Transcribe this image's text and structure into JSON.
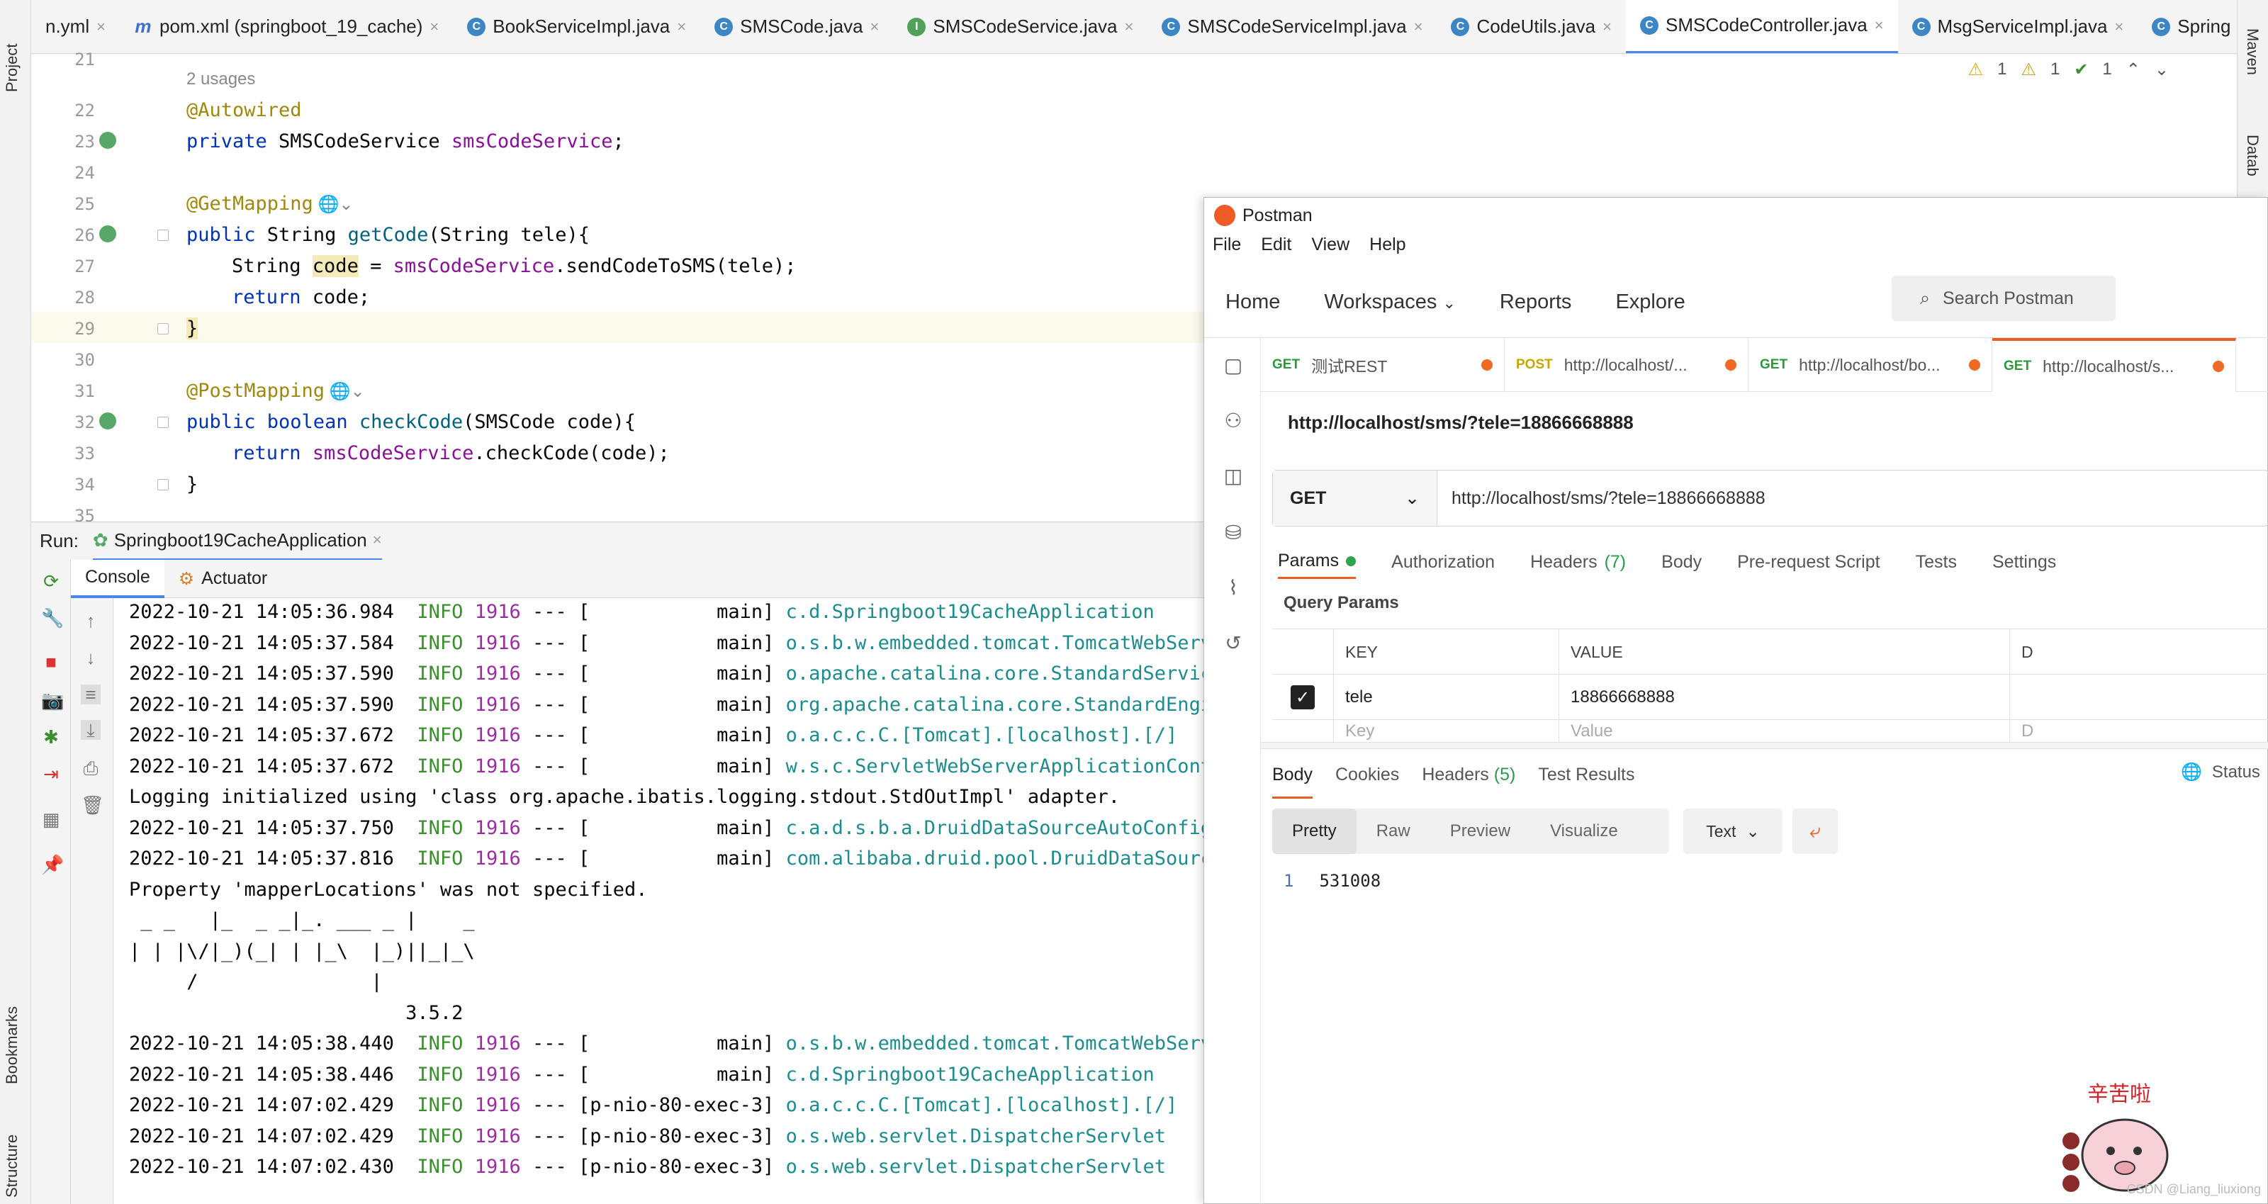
{
  "ide": {
    "left_stripe": {
      "project": "Project",
      "bookmarks": "Bookmarks",
      "structure": "Structure"
    },
    "right_stripe": {
      "maven": "Maven",
      "database": "Datab"
    },
    "tabs": [
      {
        "label": "n.yml",
        "icon": "yaml-file-icon"
      },
      {
        "label": "pom.xml (springboot_19_cache)",
        "icon": "maven-file-icon"
      },
      {
        "label": "BookServiceImpl.java",
        "icon": "class-file-icon"
      },
      {
        "label": "SMSCode.java",
        "icon": "class-file-icon"
      },
      {
        "label": "SMSCodeService.java",
        "icon": "interface-file-icon"
      },
      {
        "label": "SMSCodeServiceImpl.java",
        "icon": "class-file-icon"
      },
      {
        "label": "CodeUtils.java",
        "icon": "class-file-icon"
      },
      {
        "label": "SMSCodeController.java",
        "icon": "class-file-icon",
        "active": true
      },
      {
        "label": "MsgServiceImpl.java",
        "icon": "class-file-icon"
      },
      {
        "label": "Spring",
        "icon": "class-file-icon"
      }
    ],
    "inspections": {
      "warn1": "1",
      "warn2": "1",
      "ok": "1"
    },
    "editor": {
      "usages": "2 usages",
      "line_numbers": [
        "21",
        "22",
        "23",
        "24",
        "25",
        "26",
        "27",
        "28",
        "29",
        "30",
        "31",
        "32",
        "33",
        "34",
        "35"
      ],
      "lines": {
        "l22": "@Autowired",
        "l23_kw": "private",
        "l23_type": " SMSCodeService ",
        "l23_field": "smsCodeService",
        "l23_end": ";",
        "l25": "@GetMapping",
        "l26_kw": "public",
        "l26_rest1": " String ",
        "l26_method": "getCode",
        "l26_rest2": "(String tele){",
        "l27_a": "String ",
        "l27_var": "code",
        "l27_b": " = ",
        "l27_field": "smsCodeService",
        "l27_c": ".sendCodeToSMS(tele);",
        "l28_kw": "return",
        "l28_rest": " code;",
        "l29": "}",
        "l31": "@PostMapping",
        "l32_kw": "public boolean",
        "l32_method": " checkCode",
        "l32_rest": "(SMSCode code){",
        "l33_kw": "return",
        "l33_field": " smsCodeService",
        "l33_rest": ".checkCode(code);",
        "l34": "}"
      }
    },
    "run": {
      "label": "Run:",
      "config": "Springboot19CacheApplication",
      "console_tab": "Console",
      "actuator_tab": "Actuator"
    },
    "console_lines": [
      {
        "ts": "2022-10-21 14:05:36.984",
        "level": "INFO",
        "pid": "1916",
        "thread": "--- [           main]",
        "cls": "c.d.Springboot19CacheApplication"
      },
      {
        "ts": "2022-10-21 14:05:37.584",
        "level": "INFO",
        "pid": "1916",
        "thread": "--- [           main]",
        "cls": "o.s.b.w.embedded.tomcat.TomcatWebServe"
      },
      {
        "ts": "2022-10-21 14:05:37.590",
        "level": "INFO",
        "pid": "1916",
        "thread": "--- [           main]",
        "cls": "o.apache.catalina.core.StandardService"
      },
      {
        "ts": "2022-10-21 14:05:37.590",
        "level": "INFO",
        "pid": "1916",
        "thread": "--- [           main]",
        "cls": "org.apache.catalina.core.StandardEngin"
      },
      {
        "ts": "2022-10-21 14:05:37.672",
        "level": "INFO",
        "pid": "1916",
        "thread": "--- [           main]",
        "cls": "o.a.c.c.C.[Tomcat].[localhost].[/]"
      },
      {
        "ts": "2022-10-21 14:05:37.672",
        "level": "INFO",
        "pid": "1916",
        "thread": "--- [           main]",
        "cls": "w.s.c.ServletWebServerApplicationConte"
      }
    ],
    "console_plain1": "Logging initialized using 'class org.apache.ibatis.logging.stdout.StdOutImpl' adapter.",
    "console_lines2": [
      {
        "ts": "2022-10-21 14:05:37.750",
        "level": "INFO",
        "pid": "1916",
        "thread": "--- [           main]",
        "cls": "c.a.d.s.b.a.DruidDataSourceAutoConfigu"
      },
      {
        "ts": "2022-10-21 14:05:37.816",
        "level": "INFO",
        "pid": "1916",
        "thread": "--- [           main]",
        "cls": "com.alibaba.druid.pool.DruidDataSource"
      }
    ],
    "console_plain2": "Property 'mapperLocations' was not specified.",
    "banner": [
      " _ _   |_  _ _|_. ___ _ |    _",
      "| | |\\/|_)(_| | |_\\  |_)||_|_\\",
      "     /               |",
      "                        3.5.2"
    ],
    "console_lines3": [
      {
        "ts": "2022-10-21 14:05:38.440",
        "level": "INFO",
        "pid": "1916",
        "thread": "--- [           main]",
        "cls": "o.s.b.w.embedded.tomcat.TomcatWebServe"
      },
      {
        "ts": "2022-10-21 14:05:38.446",
        "level": "INFO",
        "pid": "1916",
        "thread": "--- [           main]",
        "cls": "c.d.Springboot19CacheApplication"
      },
      {
        "ts": "2022-10-21 14:07:02.429",
        "level": "INFO",
        "pid": "1916",
        "thread": "--- [p-nio-80-exec-3]",
        "cls": "o.a.c.c.C.[Tomcat].[localhost].[/]"
      },
      {
        "ts": "2022-10-21 14:07:02.429",
        "level": "INFO",
        "pid": "1916",
        "thread": "--- [p-nio-80-exec-3]",
        "cls": "o.s.web.servlet.DispatcherServlet"
      },
      {
        "ts": "2022-10-21 14:07:02.430",
        "level": "INFO",
        "pid": "1916",
        "thread": "--- [p-nio-80-exec-3]",
        "cls": "o.s.web.servlet.DispatcherServlet"
      }
    ]
  },
  "postman": {
    "title": "Postman",
    "menu": [
      "File",
      "Edit",
      "View",
      "Help"
    ],
    "nav": {
      "home": "Home",
      "workspaces": "Workspaces",
      "reports": "Reports",
      "explore": "Explore"
    },
    "search_placeholder": "Search Postman",
    "request_tabs": [
      {
        "method": "GET",
        "label": "测试REST"
      },
      {
        "method": "POST",
        "label": "http://localhost/..."
      },
      {
        "method": "GET",
        "label": "http://localhost/bo..."
      },
      {
        "method": "GET",
        "label": "http://localhost/s...",
        "active": true
      }
    ],
    "request_name": "http://localhost/sms/?tele=18866668888",
    "method": "GET",
    "url": "http://localhost/sms/?tele=18866668888",
    "req_tabs": {
      "params": "Params",
      "authorization": "Authorization",
      "headers": "Headers",
      "headers_count": "(7)",
      "body": "Body",
      "prerequest": "Pre-request Script",
      "tests": "Tests",
      "settings": "Settings"
    },
    "query_params_title": "Query Params",
    "table": {
      "key_header": "KEY",
      "value_header": "VALUE",
      "desc_header": "D",
      "row_key": "tele",
      "row_value": "18866668888",
      "placeholder_key": "Key",
      "placeholder_value": "Value",
      "placeholder_desc": "D"
    },
    "res_tabs": {
      "body": "Body",
      "cookies": "Cookies",
      "headers": "Headers",
      "headers_count": "(5)",
      "test_results": "Test Results"
    },
    "status_label": "Status",
    "view_buttons": {
      "pretty": "Pretty",
      "raw": "Raw",
      "preview": "Preview",
      "visualize": "Visualize"
    },
    "format": "Text",
    "response_line_no": "1",
    "response_body": "531008"
  },
  "sticker_text": "辛苦啦",
  "watermark": "CSDN @Liang_liuxiong",
  "colors": {
    "accent": "#ef5b25",
    "ide_accent": "#4a86e8",
    "info": "#3c8f2f",
    "class": "#1e8c8c"
  }
}
